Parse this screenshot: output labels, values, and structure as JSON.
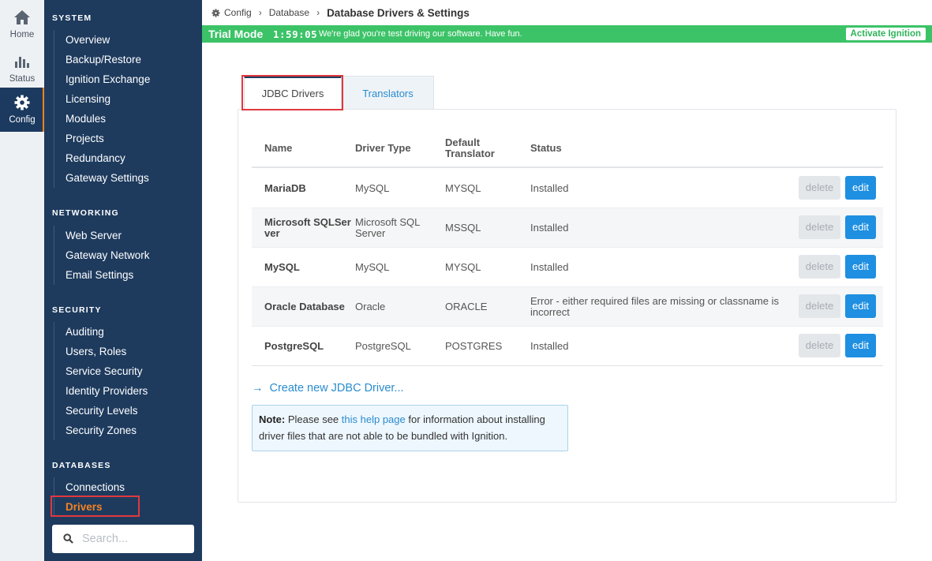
{
  "rail": {
    "items": [
      {
        "label": "Home",
        "icon": "home-icon"
      },
      {
        "label": "Status",
        "icon": "bar-chart-icon"
      },
      {
        "label": "Config",
        "icon": "gear-icon",
        "active": true
      }
    ]
  },
  "sidebar": {
    "sections": [
      {
        "title": "SYSTEM",
        "items": [
          "Overview",
          "Backup/Restore",
          "Ignition Exchange",
          "Licensing",
          "Modules",
          "Projects",
          "Redundancy",
          "Gateway Settings"
        ]
      },
      {
        "title": "NETWORKING",
        "items": [
          "Web Server",
          "Gateway Network",
          "Email Settings"
        ]
      },
      {
        "title": "SECURITY",
        "items": [
          "Auditing",
          "Users, Roles",
          "Service Security",
          "Identity Providers",
          "Security Levels",
          "Security Zones"
        ]
      },
      {
        "title": "DATABASES",
        "items": [
          "Connections",
          "Drivers"
        ],
        "active_item": "Drivers"
      }
    ],
    "search_placeholder": "Search..."
  },
  "breadcrumb": {
    "items": [
      "Config",
      "Database"
    ],
    "current": "Database Drivers & Settings"
  },
  "trial": {
    "mode_label": "Trial Mode",
    "timer": "1:59:05",
    "message": "We're glad you're test driving our software. Have fun.",
    "activate_label": "Activate Ignition"
  },
  "tabs": [
    {
      "label": "JDBC Drivers",
      "active": true
    },
    {
      "label": "Translators",
      "active": false
    }
  ],
  "table": {
    "headers": {
      "name": "Name",
      "driver_type": "Driver Type",
      "default_translator_1": "Default",
      "default_translator_2": "Translator",
      "status": "Status"
    },
    "rows": [
      {
        "name": "MariaDB",
        "type": "MySQL",
        "translator": "MYSQL",
        "status": "Installed"
      },
      {
        "name": "Microsoft SQLServer",
        "name_l1": "Microsoft SQLSer",
        "name_l2": "ver",
        "type": "Microsoft SQL Server",
        "type_l1": "Microsoft SQL",
        "type_l2": "Server",
        "translator": "MSSQL",
        "status": "Installed"
      },
      {
        "name": "MySQL",
        "type": "MySQL",
        "translator": "MYSQL",
        "status": "Installed"
      },
      {
        "name": "Oracle Database",
        "type": "Oracle",
        "translator": "ORACLE",
        "status": "Error - either required files are missing or classname is incorrect",
        "status_l1": "Error - either required files are missing or classname is",
        "status_l2": "incorrect"
      },
      {
        "name": "PostgreSQL",
        "type": "PostgreSQL",
        "translator": "POSTGRES",
        "status": "Installed"
      }
    ],
    "delete_label": "delete",
    "edit_label": "edit"
  },
  "create_link": "Create new JDBC Driver...",
  "note": {
    "bold": "Note:",
    "before": "Please see",
    "link": "this help page",
    "after_line1": "for information about installing",
    "line2": "driver files that are not able to be bundled with Ignition."
  },
  "colors": {
    "sidebar_bg": "#1e3b5e",
    "accent_orange": "#f58220",
    "trial_green": "#3cc367",
    "link_blue": "#2a8ccf",
    "edit_blue": "#1e8fe1",
    "highlight_red": "#e0393e"
  }
}
